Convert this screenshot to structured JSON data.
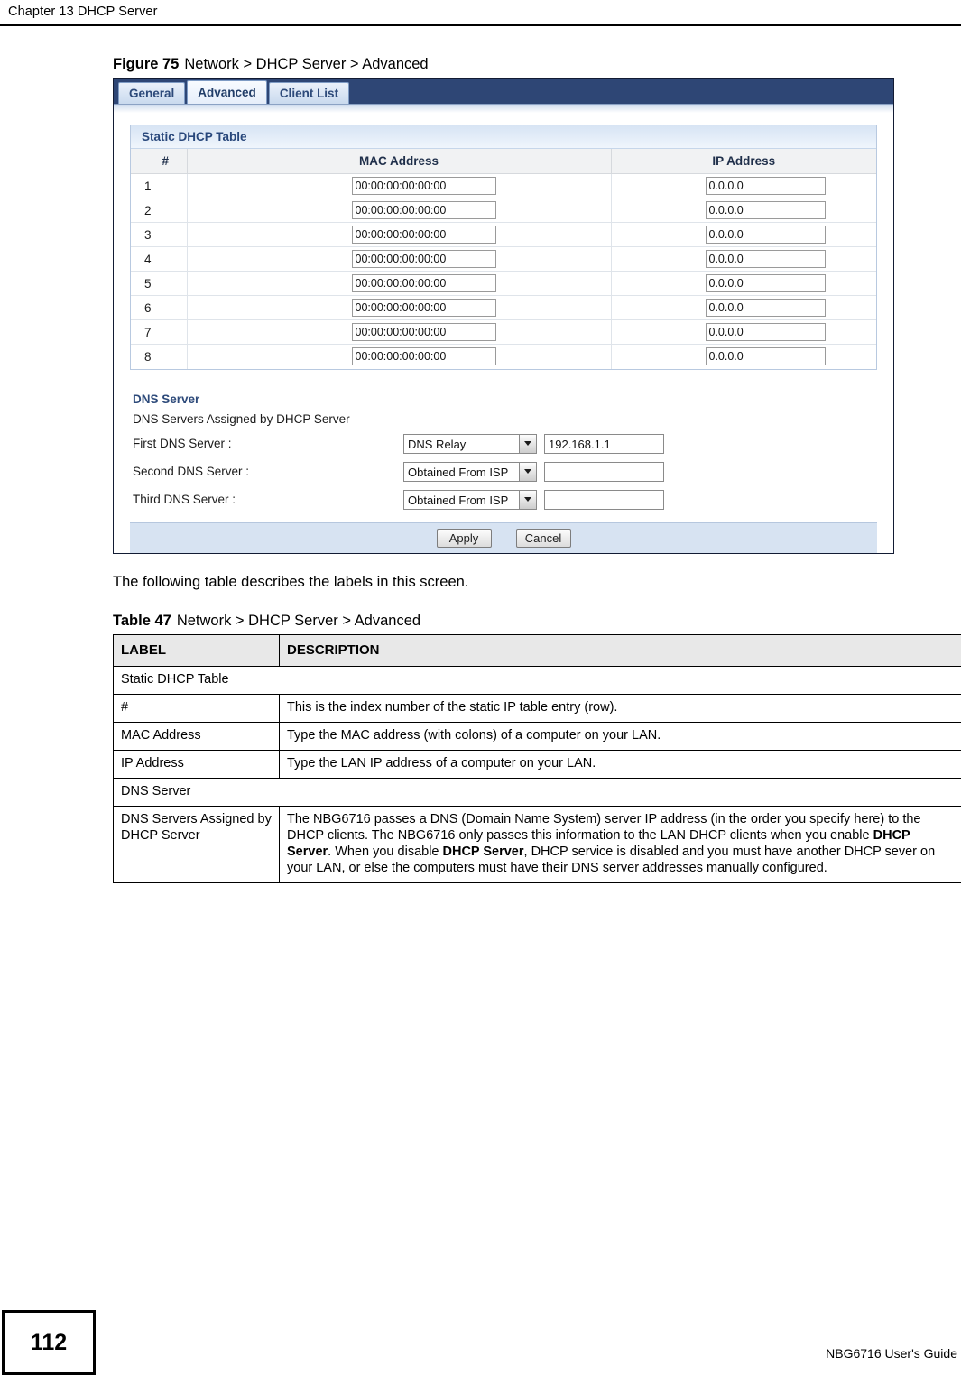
{
  "page": {
    "chapter_title": "Chapter 13 DHCP Server",
    "page_number": "112",
    "footer_text": "NBG6716 User's Guide"
  },
  "figure": {
    "caption_lead": "Figure 75",
    "caption_text": "Network > DHCP Server > Advanced"
  },
  "screen": {
    "tabs": [
      {
        "label": "General",
        "active": false
      },
      {
        "label": "Advanced",
        "active": true
      },
      {
        "label": "Client List",
        "active": false
      }
    ],
    "static_dhcp": {
      "title": "Static DHCP Table",
      "columns": [
        "#",
        "MAC Address",
        "IP Address"
      ],
      "rows": [
        {
          "index": "1",
          "mac": "00:00:00:00:00:00",
          "ip": "0.0.0.0"
        },
        {
          "index": "2",
          "mac": "00:00:00:00:00:00",
          "ip": "0.0.0.0"
        },
        {
          "index": "3",
          "mac": "00:00:00:00:00:00",
          "ip": "0.0.0.0"
        },
        {
          "index": "4",
          "mac": "00:00:00:00:00:00",
          "ip": "0.0.0.0"
        },
        {
          "index": "5",
          "mac": "00:00:00:00:00:00",
          "ip": "0.0.0.0"
        },
        {
          "index": "6",
          "mac": "00:00:00:00:00:00",
          "ip": "0.0.0.0"
        },
        {
          "index": "7",
          "mac": "00:00:00:00:00:00",
          "ip": "0.0.0.0"
        },
        {
          "index": "8",
          "mac": "00:00:00:00:00:00",
          "ip": "0.0.0.0"
        }
      ]
    },
    "dns": {
      "heading": "DNS Server",
      "subheading": "DNS Servers Assigned by DHCP Server",
      "rows": [
        {
          "label": "First DNS Server :",
          "select_value": "DNS Relay",
          "input_value": "192.168.1.1"
        },
        {
          "label": "Second DNS Server :",
          "select_value": "Obtained From ISP",
          "input_value": ""
        },
        {
          "label": "Third DNS Server :",
          "select_value": "Obtained From ISP",
          "input_value": ""
        }
      ]
    },
    "buttons": {
      "apply": "Apply",
      "cancel": "Cancel"
    }
  },
  "body_text": {
    "intro_paragraph": "The following table describes the labels in this screen."
  },
  "ref_table": {
    "caption_lead": "Table 47",
    "caption_text": "Network > DHCP Server > Advanced",
    "headers": [
      "LABEL",
      "DESCRIPTION"
    ],
    "rows": [
      {
        "type": "span",
        "label": "Static DHCP Table",
        "description": ""
      },
      {
        "type": "pair",
        "label": "#",
        "description": "This is the index number of the static IP table entry (row)."
      },
      {
        "type": "pair",
        "label": "MAC Address",
        "description": "Type the MAC address (with colons) of a computer on your LAN."
      },
      {
        "type": "pair",
        "label": "IP Address",
        "description": "Type the LAN IP address of a computer on your LAN."
      },
      {
        "type": "span",
        "label": "DNS Server",
        "description": ""
      },
      {
        "type": "rich",
        "label": "DNS Servers Assigned by DHCP Server",
        "description_parts": [
          {
            "text": "The NBG6716 passes a DNS (Domain Name System) server IP address (in the order you specify here) to the DHCP clients. The NBG6716 only passes this information to the LAN DHCP clients when you enable ",
            "bold": false
          },
          {
            "text": "DHCP Server",
            "bold": true
          },
          {
            "text": ". When you disable ",
            "bold": false
          },
          {
            "text": "DHCP Server",
            "bold": true
          },
          {
            "text": ", DHCP service is disabled and you must have another DHCP sever on your LAN, or else the computers must have their DNS server addresses manually configured.",
            "bold": false
          }
        ]
      }
    ]
  }
}
